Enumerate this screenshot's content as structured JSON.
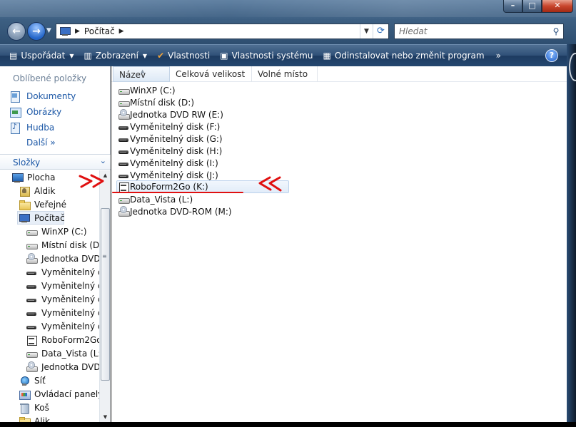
{
  "address": {
    "crumb": "Počítač"
  },
  "search": {
    "placeholder": "Hledat"
  },
  "toolbar": {
    "organize": "Uspořádat",
    "views": "Zobrazení",
    "properties": "Vlastnosti",
    "system_properties": "Vlastnosti systému",
    "uninstall": "Odinstalovat nebo změnit program",
    "more": "»",
    "help": "?"
  },
  "favorites": {
    "title": "Oblíbené položky",
    "items": [
      {
        "label": "Dokumenty",
        "icon": "documents-icon"
      },
      {
        "label": "Obrázky",
        "icon": "pictures-icon"
      },
      {
        "label": "Hudba",
        "icon": "music-icon"
      }
    ],
    "more": "Další  »"
  },
  "folders": {
    "title": "Složky",
    "tree": [
      {
        "label": "Plocha",
        "icon": "desktop-icon"
      },
      {
        "label": "Aldik",
        "icon": "user-folder-icon"
      },
      {
        "label": "Veřejné",
        "icon": "folder-icon"
      },
      {
        "label": "Počítač",
        "icon": "computer-icon"
      },
      {
        "label": "WinXP (C:)",
        "icon": "hard-drive-icon"
      },
      {
        "label": "Místní disk (D:)",
        "icon": "hard-drive-icon"
      },
      {
        "label": "Jednotka DVD R",
        "icon": "dvd-drive-icon"
      },
      {
        "label": "Vyměnitelný di",
        "icon": "removable-drive-icon"
      },
      {
        "label": "Vyměnitelný di",
        "icon": "removable-drive-icon"
      },
      {
        "label": "Vyměnitelný di",
        "icon": "removable-drive-icon"
      },
      {
        "label": "Vyměnitelný di",
        "icon": "removable-drive-icon"
      },
      {
        "label": "Vyměnitelný di",
        "icon": "removable-drive-icon"
      },
      {
        "label": "RoboForm2Go",
        "icon": "roboform-drive-icon"
      },
      {
        "label": "Data_Vista (L:)",
        "icon": "hard-drive-icon"
      },
      {
        "label": "Jednotka DVD-",
        "icon": "dvd-drive-icon"
      },
      {
        "label": "Síť",
        "icon": "network-icon"
      },
      {
        "label": "Ovládací panely",
        "icon": "control-panel-icon"
      },
      {
        "label": "Koš",
        "icon": "recycle-bin-icon"
      },
      {
        "label": "Alik",
        "icon": "folder-icon"
      }
    ]
  },
  "columns": {
    "name": "Název",
    "total_size": "Celková velikost",
    "free_space": "Volné místo"
  },
  "drives": [
    {
      "label": "WinXP (C:)",
      "icon": "hard-drive-icon"
    },
    {
      "label": "Místní disk (D:)",
      "icon": "hard-drive-icon"
    },
    {
      "label": "Jednotka DVD RW (E:)",
      "icon": "dvd-drive-icon"
    },
    {
      "label": "Vyměnitelný disk (F:)",
      "icon": "removable-drive-icon"
    },
    {
      "label": "Vyměnitelný disk (G:)",
      "icon": "removable-drive-icon"
    },
    {
      "label": "Vyměnitelný disk (H:)",
      "icon": "removable-drive-icon"
    },
    {
      "label": "Vyměnitelný disk (I:)",
      "icon": "removable-drive-icon"
    },
    {
      "label": "Vyměnitelný disk (J:)",
      "icon": "removable-drive-icon"
    },
    {
      "label": "RoboForm2Go (K:)",
      "icon": "roboform-drive-icon"
    },
    {
      "label": "Data_Vista (L:)",
      "icon": "hard-drive-icon"
    },
    {
      "label": "Jednotka DVD-ROM (M:)",
      "icon": "dvd-drive-icon"
    }
  ],
  "annotations": {
    "arrow_color": "#e01010"
  }
}
